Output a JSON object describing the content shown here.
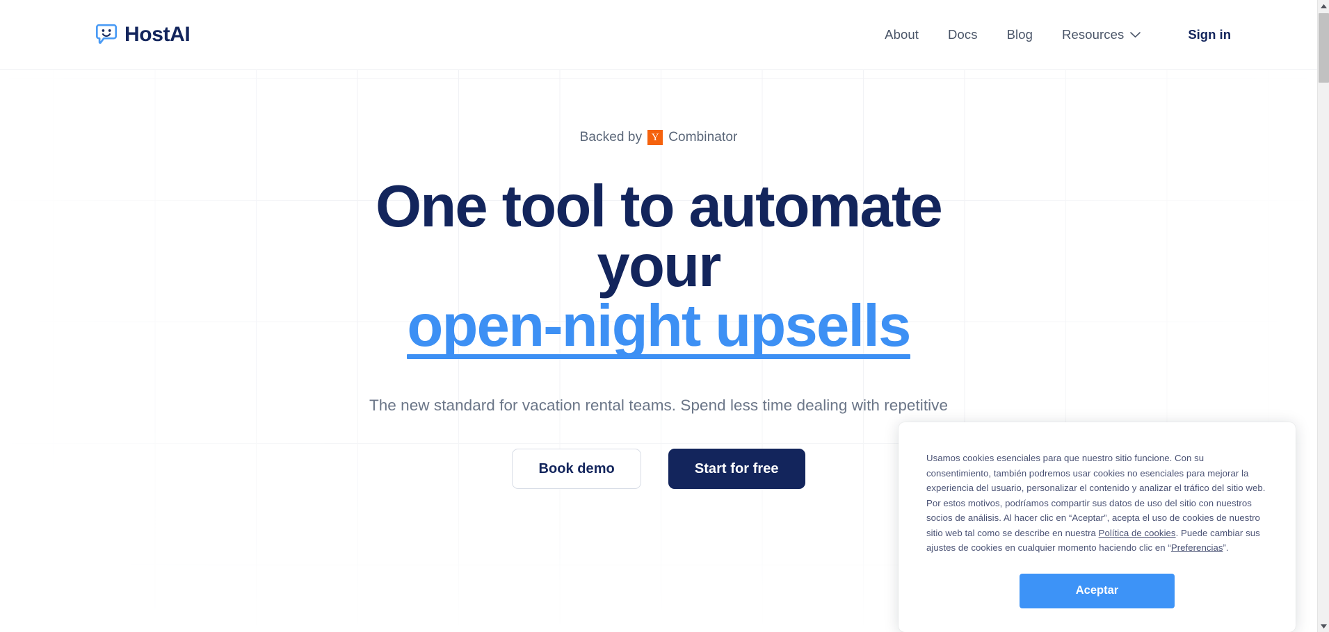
{
  "brand": {
    "name": "HostAI",
    "logo_icon": "speech-bubble-smiley-icon",
    "logo_color": "#4a9bf5",
    "wordmark_color": "#13255c"
  },
  "header": {
    "nav_items": [
      {
        "label": "About",
        "has_caret": false
      },
      {
        "label": "Docs",
        "has_caret": false
      },
      {
        "label": "Blog",
        "has_caret": false
      },
      {
        "label": "Resources",
        "has_caret": true,
        "caret_icon": "chevron-down-icon"
      }
    ],
    "sign_in_label": "Sign in"
  },
  "hero": {
    "backed_by_prefix": "Backed by",
    "yc_badge_letter": "Y",
    "backed_by_suffix": "Combinator",
    "headline_line1": "One tool to automate your",
    "headline_highlight": "open-night upsells",
    "headline_color": "#13255c",
    "highlight_color": "#3d90f4",
    "subheading": "The new standard for vacation rental teams. Spend less time dealing with repetitive",
    "cta_secondary": "Book demo",
    "cta_primary": "Start for free"
  },
  "cookie_dialog": {
    "paragraph_part1": "Usamos cookies esenciales para que nuestro sitio funcione. Con su consentimiento, también podremos usar cookies no esenciales para mejorar la experiencia del usuario, personalizar el contenido y analizar el tráfico del sitio web. Por estos motivos, podríamos compartir sus datos de uso del sitio con nuestros socios de análisis. Al hacer clic en “Aceptar”, acepta el uso de cookies de nuestro sitio web tal como se describe en nuestra ",
    "link_policy": "Política de cookies",
    "paragraph_part2": ". Puede cambiar sus ajustes de cookies en cualquier momento haciendo clic en “",
    "link_preferences": "Preferencias",
    "paragraph_part3": "”.",
    "accept_label": "Aceptar",
    "accept_color": "#3d93f7"
  },
  "scrollbar": {
    "up_arrow_icon": "triangle-up-icon",
    "down_arrow_icon": "triangle-down-icon",
    "thumb_icon": "scrollbar-thumb"
  }
}
